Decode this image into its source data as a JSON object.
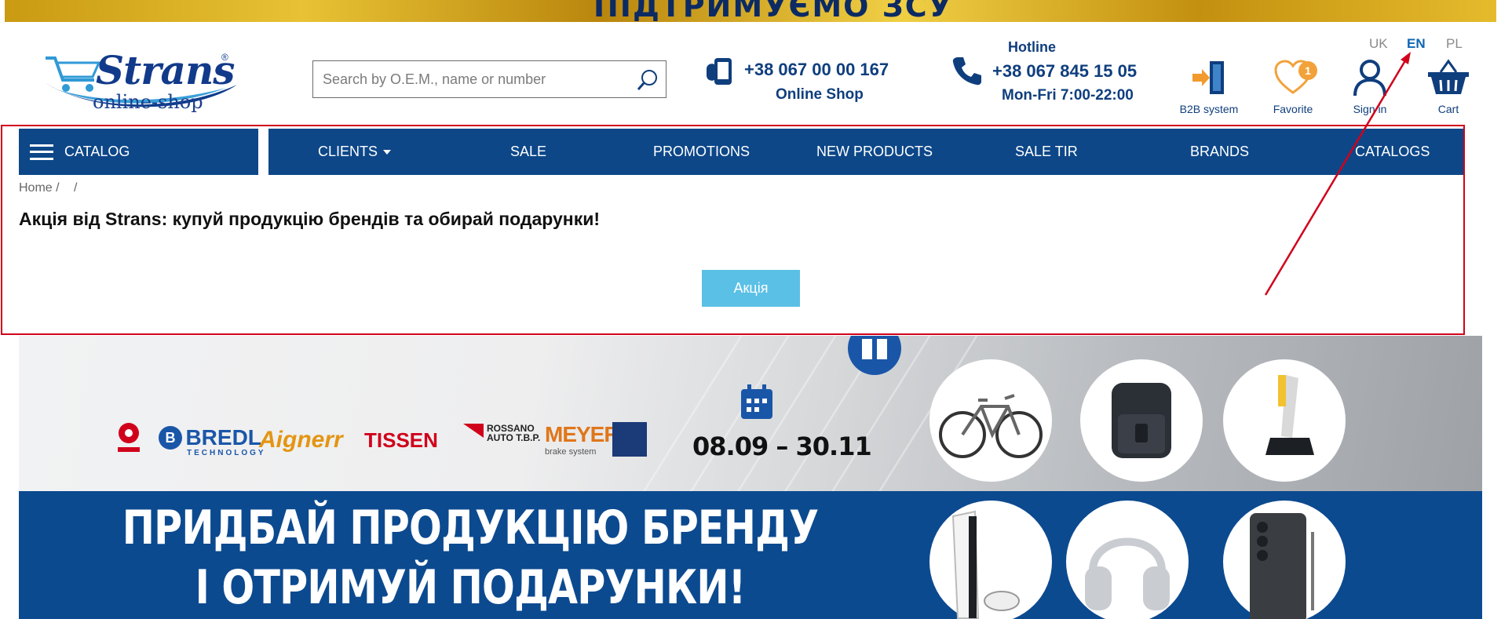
{
  "top_banner": {
    "text": "ПІДТРИМУЄМО ЗСУ"
  },
  "logo": {
    "word": "Strans",
    "sub": "online-shop",
    "reg": "®"
  },
  "search": {
    "placeholder": "Search by O.E.M., name or number"
  },
  "contacts": {
    "shop_phone": "+38 067 00 00 167",
    "shop_label": "Online Shop",
    "hotline_label": "Hotline",
    "hotline_phone": "+38 067 845 15 05",
    "hotline_hours": "Mon-Fri 7:00-22:00"
  },
  "header_icons": {
    "b2b": "B2B system",
    "favorite": "Favorite",
    "favorite_count": "1",
    "sign_in": "Sign in",
    "cart": "Cart"
  },
  "languages": [
    {
      "code": "UK",
      "active": false
    },
    {
      "code": "EN",
      "active": true
    },
    {
      "code": "PL",
      "active": false
    }
  ],
  "nav": {
    "catalog": "CATALOG",
    "items": [
      "CLIENTS",
      "SALE",
      "PROMOTIONS",
      "NEW PRODUCTS",
      "SALE TIR",
      "BRANDS",
      "CATALOGS"
    ]
  },
  "breadcrumb": {
    "home": "Home",
    "sep1": "/",
    "sep2": "/"
  },
  "page": {
    "title": "Акція від Strans: купуй продукцію брендів та обирай подарунки!",
    "action_button": "Акція"
  },
  "promo": {
    "brands": [
      "BREDL",
      "Aignerr",
      "TISSEN",
      "ROSSANO AUTO T.B.P.",
      "MEYER"
    ],
    "bredl_sub": "TECHNOLOGY",
    "meyer_sub": "brake system",
    "dates": "08.09 – 30.11",
    "headline_line1": "ПРИДБАЙ ПРОДУКЦІЮ БРЕНДУ",
    "headline_line2": "І ОТРИМУЙ ПОДАРУНКИ!"
  },
  "colors": {
    "nav_blue": "#0d4788",
    "text_blue": "#0f3e7d",
    "button_cyan": "#5bc0e6",
    "annotation_red": "#d0021b",
    "badge_orange": "#f2a23b"
  }
}
